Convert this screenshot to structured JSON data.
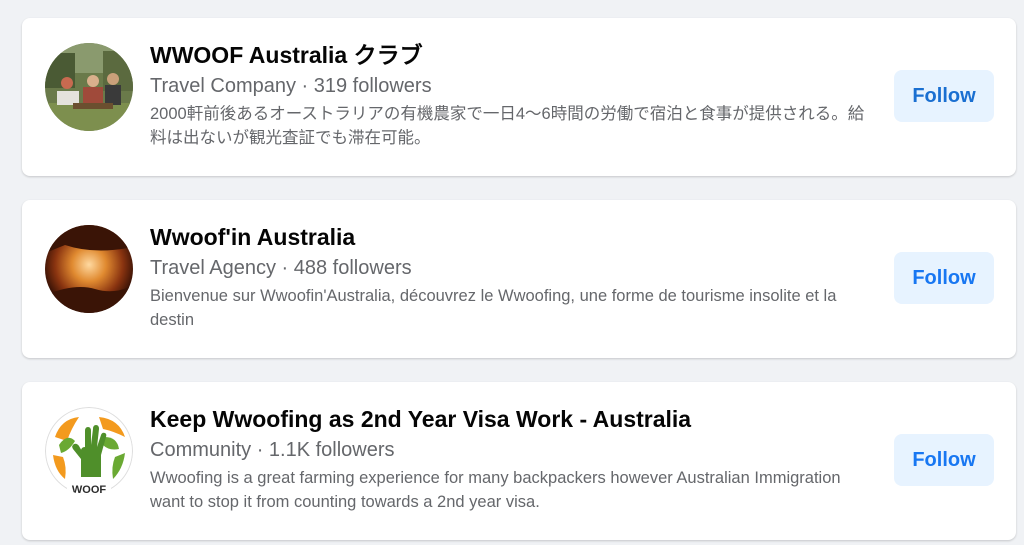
{
  "results": [
    {
      "name": "WWOOF Australia クラブ",
      "meta": "Travel Company · 319 followers",
      "description": "2000軒前後あるオーストラリアの有機農家で一日4〜6時間の労働で宿泊と食事が提供される。給料は出ないが観光査証でも滞在可能。",
      "avatar_icon": "outdoor-photo",
      "follow_label": "Follow"
    },
    {
      "name": "Wwoof'in Australia",
      "meta": "Travel Agency · 488 followers",
      "description": "Bienvenue sur Wwoofin'Australia, découvrez le Wwoofing, une forme de tourisme insolite et la destin",
      "avatar_icon": "cave-photo",
      "follow_label": "Follow"
    },
    {
      "name": "Keep Wwoofing as 2nd Year Visa Work - Australia",
      "meta": "Community · 1.1K followers",
      "description": "Wwoofing is a great farming experience for many backpackers however Australian Immigration want to stop it from counting towards a 2nd year visa.",
      "avatar_icon": "wwoof-logo",
      "follow_label": "Follow"
    }
  ],
  "colors": {
    "page_background": "#f0f2f5",
    "card_background": "#ffffff",
    "primary_text": "#050505",
    "secondary_text": "#65676b",
    "follow_button_bg": "#e7f3ff",
    "follow_button_text": "#1877f2"
  }
}
